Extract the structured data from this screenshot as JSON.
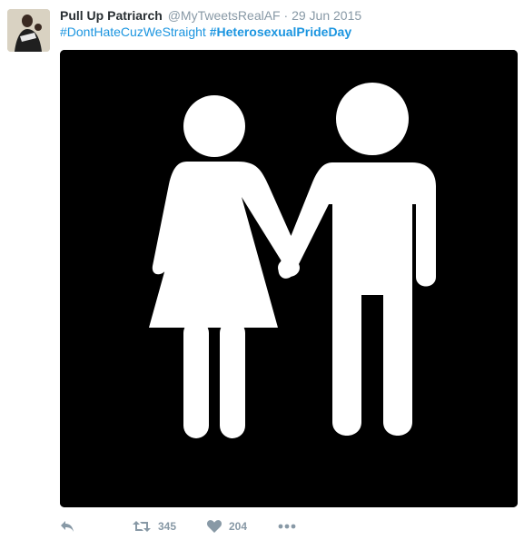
{
  "tweet": {
    "author_name": "Pull Up Patriarch",
    "handle": "@MyTweetsRealAF",
    "separator": "·",
    "date": "29 Jun 2015",
    "hashtag_1": "#DontHateCuzWeStraight",
    "hashtag_2": "#HeterosexualPrideDay"
  },
  "media": {
    "icon": "couple-restroom-sign-icon",
    "background_color": "#000000",
    "figure_color": "#ffffff"
  },
  "actions": {
    "reply_icon": "reply-icon",
    "retweet_icon": "retweet-icon",
    "retweet_count": "345",
    "like_icon": "heart-icon",
    "like_count": "204",
    "more_icon": "more-dots-icon"
  },
  "colors": {
    "link": "#1b95e0",
    "muted": "#8899a6",
    "name": "#292f33"
  }
}
